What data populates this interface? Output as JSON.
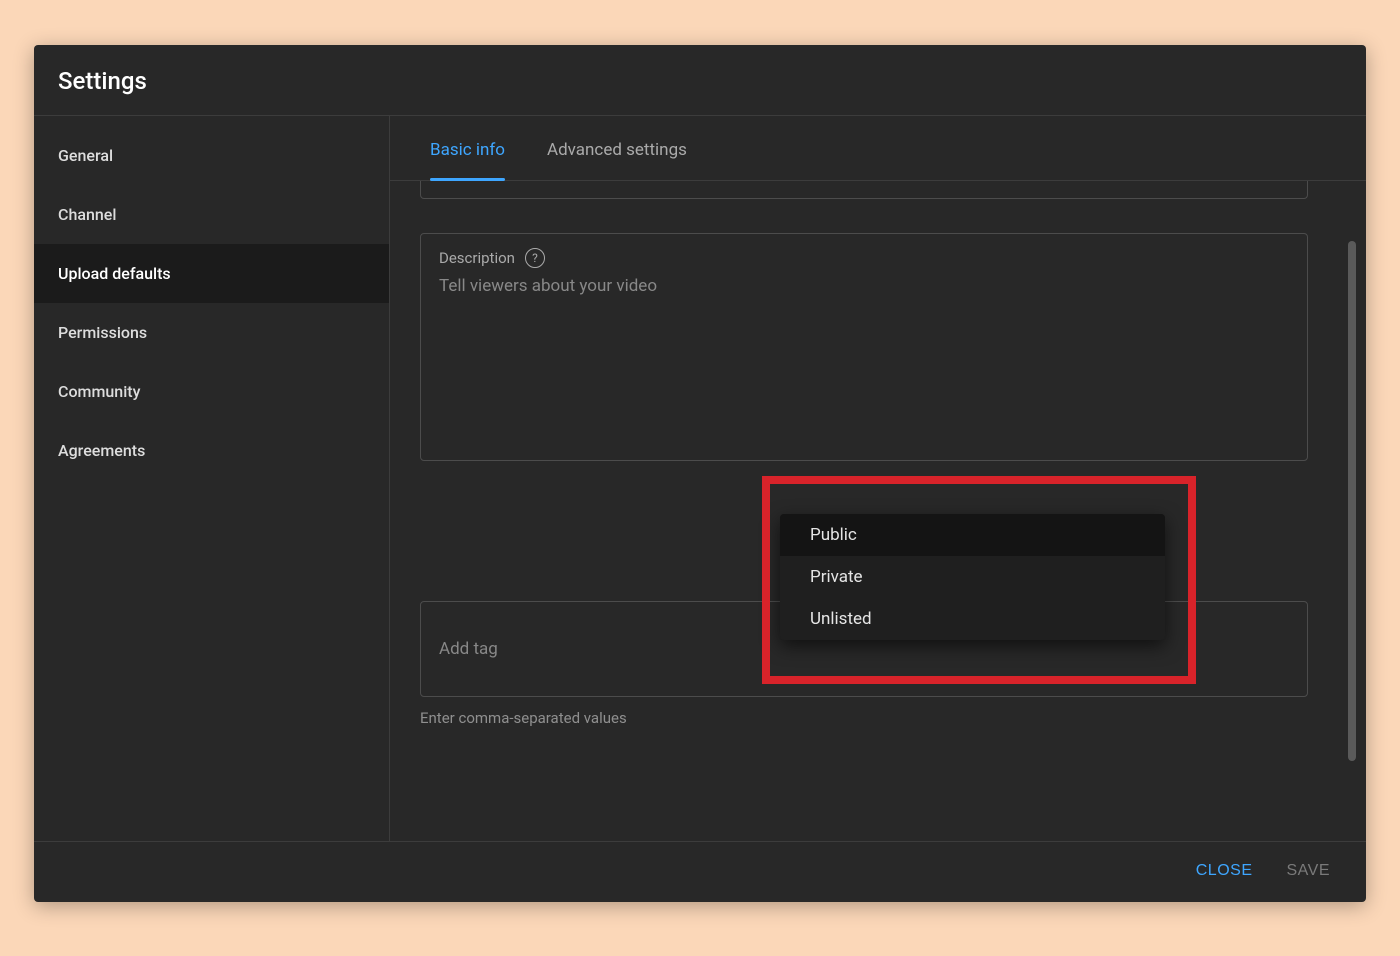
{
  "dialog": {
    "title": "Settings"
  },
  "sidebar": {
    "items": [
      {
        "label": "General",
        "active": false
      },
      {
        "label": "Channel",
        "active": false
      },
      {
        "label": "Upload defaults",
        "active": true
      },
      {
        "label": "Permissions",
        "active": false
      },
      {
        "label": "Community",
        "active": false
      },
      {
        "label": "Agreements",
        "active": false
      }
    ]
  },
  "tabs": [
    {
      "label": "Basic info",
      "active": true
    },
    {
      "label": "Advanced settings",
      "active": false
    }
  ],
  "form": {
    "description": {
      "label": "Description",
      "placeholder": "Tell viewers about your video"
    },
    "visibility_dropdown": {
      "options": [
        "Public",
        "Private",
        "Unlisted"
      ],
      "selected": "Public"
    },
    "tags": {
      "placeholder": "Add tag",
      "helper": "Enter comma-separated values"
    }
  },
  "footer": {
    "close": "CLOSE",
    "save": "SAVE"
  },
  "annotation": {
    "highlight_target": "visibility-dropdown"
  }
}
